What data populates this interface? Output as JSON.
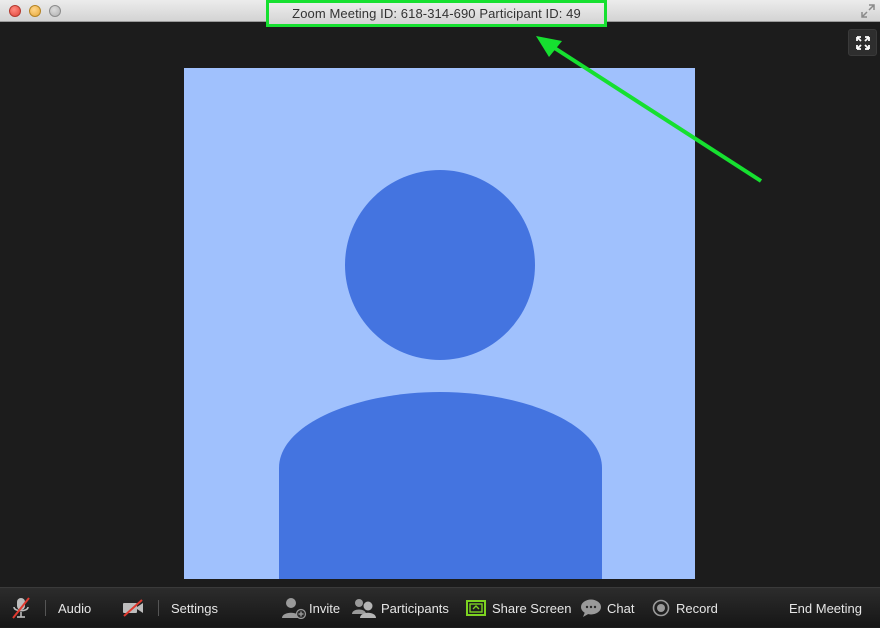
{
  "window": {
    "title": "Zoom Meeting ID: 618-314-690 Participant ID: 49"
  },
  "colors": {
    "highlight": "#16e030",
    "avatar_bg": "#a0c1fd",
    "avatar_fg": "#4474e0",
    "share_screen_accent": "#7dd321"
  },
  "toolbar": {
    "audio_label": "Audio",
    "settings_label": "Settings",
    "invite_label": "Invite",
    "participants_label": "Participants",
    "share_screen_label": "Share Screen",
    "chat_label": "Chat",
    "record_label": "Record",
    "end_meeting_label": "End Meeting"
  },
  "icons": {
    "mute": "microphone-muted-icon",
    "video": "video-camera-off-icon",
    "invite": "add-person-icon",
    "participants": "people-icon",
    "share": "share-screen-icon",
    "chat": "chat-bubble-icon",
    "record": "record-icon",
    "expand": "fullscreen-expand-icon"
  }
}
